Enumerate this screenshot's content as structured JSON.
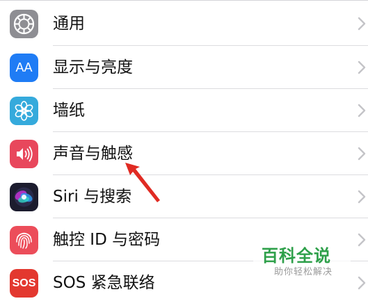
{
  "settings": {
    "items": [
      {
        "label": "通用",
        "icon": "gear-icon",
        "color": "#8e8e93"
      },
      {
        "label": "显示与亮度",
        "icon": "display-brightness-icon",
        "color": "#1f7cf5",
        "glyph": "AA"
      },
      {
        "label": "墙纸",
        "icon": "wallpaper-flower-icon",
        "color": "#35aadc"
      },
      {
        "label": "声音与触感",
        "icon": "speaker-icon",
        "color": "#e8475c"
      },
      {
        "label": "Siri 与搜索",
        "icon": "siri-icon",
        "color": "#1c1c2e"
      },
      {
        "label": "触控 ID 与密码",
        "icon": "fingerprint-icon",
        "color": "#ec4d5a"
      },
      {
        "label": "SOS 紧急联络",
        "icon": "sos-icon",
        "color": "#e3382f",
        "glyph": "SOS"
      }
    ]
  },
  "annotation": {
    "arrow_color": "#e02b23"
  },
  "watermark": {
    "title": "百科全说",
    "subtitle": "助你轻松解决",
    "color": "#2ea04a"
  }
}
